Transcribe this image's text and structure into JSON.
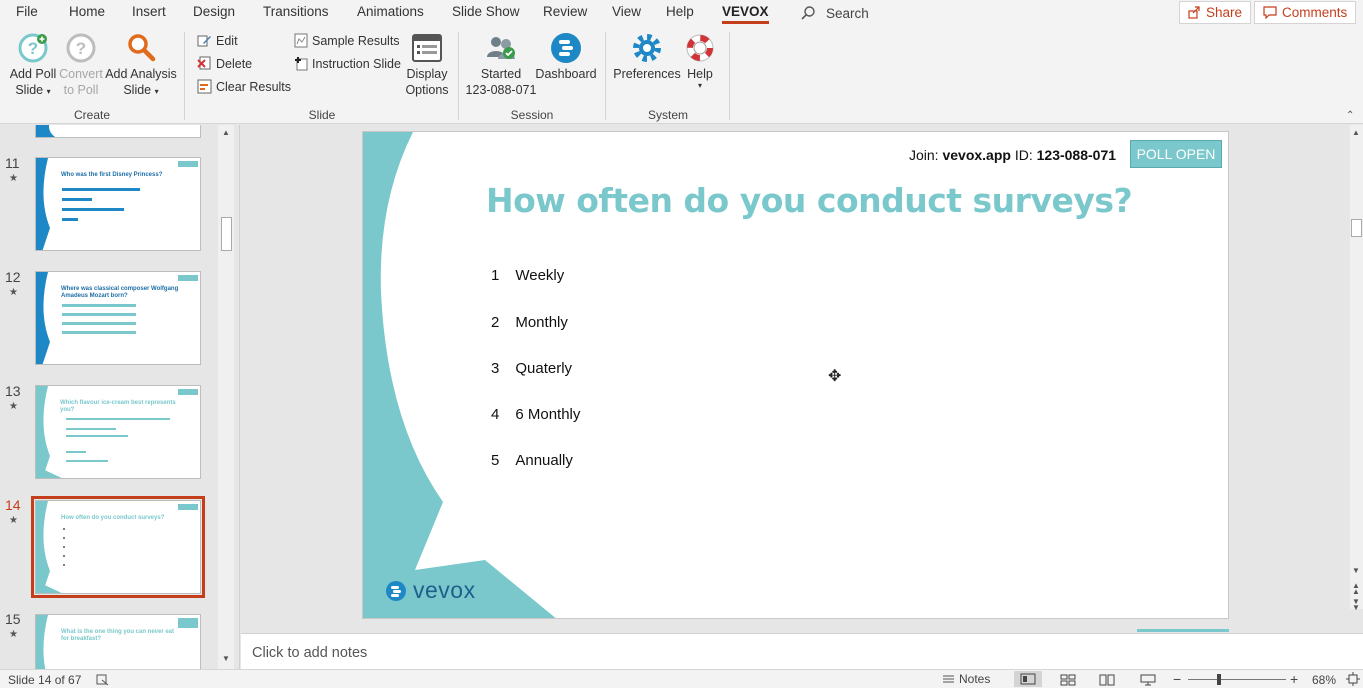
{
  "tabs": [
    "File",
    "Home",
    "Insert",
    "Design",
    "Transitions",
    "Animations",
    "Slide Show",
    "Review",
    "View",
    "Help",
    "VEVOX"
  ],
  "active_tab": "VEVOX",
  "search": {
    "label": "Search"
  },
  "header_buttons": {
    "share": "Share",
    "comments": "Comments"
  },
  "ribbon": {
    "create": {
      "label": "Create",
      "add_poll_line1": "Add Poll",
      "add_poll_line2": "Slide",
      "convert_line1": "Convert",
      "convert_line2": "to Poll",
      "add_analysis_line1": "Add Analysis",
      "add_analysis_line2": "Slide"
    },
    "slide": {
      "label": "Slide",
      "edit": "Edit",
      "delete": "Delete",
      "clear_results": "Clear Results",
      "sample_results": "Sample Results",
      "instruction_slide": "Instruction Slide",
      "display_line1": "Display",
      "display_line2": "Options"
    },
    "session": {
      "label": "Session",
      "started_line1": "Started",
      "started_line2": "123-088-071",
      "dashboard": "Dashboard"
    },
    "system": {
      "label": "System",
      "preferences": "Preferences",
      "help": "Help"
    }
  },
  "thumbnails": [
    {
      "number": "11",
      "title": "Who was the first Disney Princess?"
    },
    {
      "number": "12",
      "title": "Where was classical composer Wolfgang Amadeus Mozart born?"
    },
    {
      "number": "13",
      "title": "Which flavour ice-cream best represents you?"
    },
    {
      "number": "14",
      "title": "How often do you conduct surveys?"
    },
    {
      "number": "15",
      "title": "What is the one thing you can never eat for breakfast?"
    }
  ],
  "slide": {
    "join_prefix": "Join:",
    "join_url": "vevox.app",
    "join_id_label": "ID:",
    "join_id": "123-088-071",
    "poll_status": "POLL OPEN",
    "question": "How often do you conduct surveys?",
    "options": [
      {
        "num": "1",
        "text": "Weekly"
      },
      {
        "num": "2",
        "text": "Monthly"
      },
      {
        "num": "3",
        "text": "Quaterly"
      },
      {
        "num": "4",
        "text": "6 Monthly"
      },
      {
        "num": "5",
        "text": "Annually"
      }
    ],
    "brand": "vevox",
    "accent_color": "#7ac8cc"
  },
  "notes": {
    "placeholder": "Click to add notes"
  },
  "status": {
    "slide_info": "Slide 14 of 67",
    "notes": "Notes",
    "zoom": "68%"
  }
}
